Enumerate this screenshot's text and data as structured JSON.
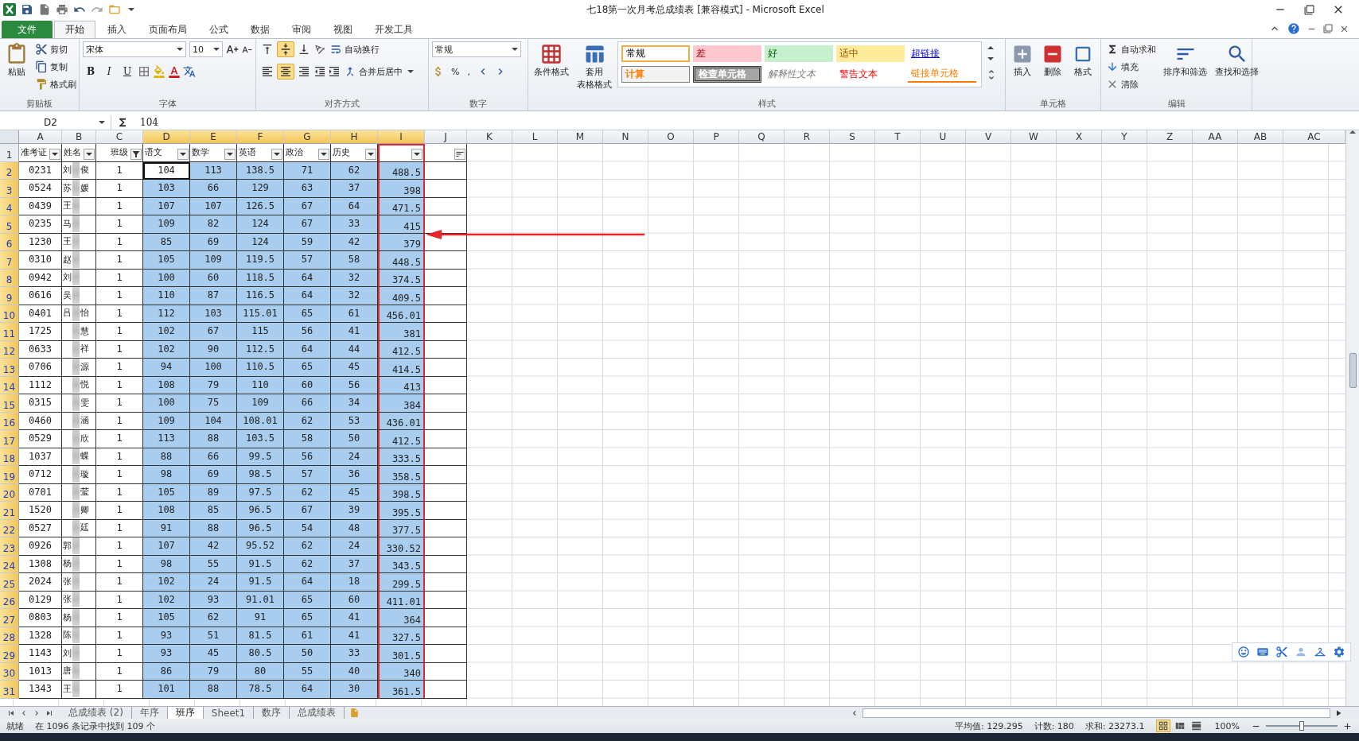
{
  "title_bar": {
    "title": "七18第一次月考总成绩表  [兼容模式]  -  Microsoft Excel"
  },
  "ribbon_tabs": [
    {
      "label": "文件",
      "kind": "file",
      "selected": false
    },
    {
      "label": "开始",
      "kind": "tab",
      "selected": true
    },
    {
      "label": "插入",
      "kind": "tab",
      "selected": false
    },
    {
      "label": "页面布局",
      "kind": "tab",
      "selected": false
    },
    {
      "label": "公式",
      "kind": "tab",
      "selected": false
    },
    {
      "label": "数据",
      "kind": "tab",
      "selected": false
    },
    {
      "label": "审阅",
      "kind": "tab",
      "selected": false
    },
    {
      "label": "视图",
      "kind": "tab",
      "selected": false
    },
    {
      "label": "开发工具",
      "kind": "tab",
      "selected": false
    }
  ],
  "clipboard": {
    "paste": "粘贴",
    "cut": "剪切",
    "copy": "复制",
    "format_painter": "格式刷",
    "label": "剪贴板"
  },
  "font": {
    "name": "宋体",
    "size": "10",
    "buttons": [
      "B",
      "I",
      "U"
    ],
    "label": "字体"
  },
  "alignment": {
    "vertical": [
      {
        "selected": false
      },
      {
        "selected": true
      },
      {
        "selected": false
      }
    ],
    "horizontal": [
      {
        "selected": false
      },
      {
        "selected": true
      },
      {
        "selected": false
      }
    ],
    "wrap": "自动换行",
    "merge": "合并后居中",
    "label": "对齐方式"
  },
  "number": {
    "format": "常规",
    "buttons": [
      "%",
      ","
    ],
    "label": "数字"
  },
  "styles": {
    "conditional": "条件格式",
    "table": [
      "套用",
      "表格格式"
    ],
    "cells": [
      {
        "label": "常规",
        "kind": "normal"
      },
      {
        "label": "差",
        "kind": "bad"
      },
      {
        "label": "好",
        "kind": "good"
      },
      {
        "label": "适中",
        "kind": "neutral"
      },
      {
        "label": "超链接",
        "kind": "hyperlink"
      },
      {
        "label": "计算",
        "kind": "calc"
      },
      {
        "label": "检查单元格",
        "kind": "check"
      },
      {
        "label": "解释性文本",
        "kind": "explanatory"
      },
      {
        "label": "警告文本",
        "kind": "warning"
      },
      {
        "label": "链接单元格",
        "kind": "linked"
      }
    ],
    "label": "样式"
  },
  "cells_group": {
    "buttons": [
      "插入",
      "删除",
      "格式"
    ],
    "label": "单元格"
  },
  "editing": {
    "autosum": "自动求和",
    "fill": "填充",
    "clear": "清除",
    "sort": "排序和筛选",
    "find": "查找和选择",
    "label": "编辑"
  },
  "formula_bar": {
    "name_box": "D2",
    "value": "104"
  },
  "sheet": {
    "columns": [
      {
        "label": "A",
        "selected": false,
        "outlined": false
      },
      {
        "label": "B",
        "selected": false,
        "outlined": false
      },
      {
        "label": "C",
        "selected": false,
        "outlined": false
      },
      {
        "label": "D",
        "selected": true,
        "outlined": false
      },
      {
        "label": "E",
        "selected": true,
        "outlined": false
      },
      {
        "label": "F",
        "selected": true,
        "outlined": false
      },
      {
        "label": "G",
        "selected": true,
        "outlined": false
      },
      {
        "label": "H",
        "selected": true,
        "outlined": false
      },
      {
        "label": "I",
        "selected": true,
        "outlined": true
      },
      {
        "label": "J",
        "selected": false,
        "outlined": false
      },
      {
        "label": "K",
        "selected": false,
        "outlined": false
      },
      {
        "label": "L",
        "selected": false,
        "outlined": false
      },
      {
        "label": "M",
        "selected": false,
        "outlined": false
      },
      {
        "label": "N",
        "selected": false,
        "outlined": false
      },
      {
        "label": "O",
        "selected": false,
        "outlined": false
      },
      {
        "label": "P",
        "selected": false,
        "outlined": false
      },
      {
        "label": "Q",
        "selected": false,
        "outlined": false
      },
      {
        "label": "R",
        "selected": false,
        "outlined": false
      },
      {
        "label": "S",
        "selected": false,
        "outlined": false
      },
      {
        "label": "T",
        "selected": false,
        "outlined": false
      },
      {
        "label": "U",
        "selected": false,
        "outlined": false
      },
      {
        "label": "V",
        "selected": false,
        "outlined": false
      },
      {
        "label": "W",
        "selected": false,
        "outlined": false
      },
      {
        "label": "X",
        "selected": false,
        "outlined": false
      },
      {
        "label": "Y",
        "selected": false,
        "outlined": false
      },
      {
        "label": "Z",
        "selected": false,
        "outlined": false
      },
      {
        "label": "AA",
        "selected": false,
        "outlined": false
      },
      {
        "label": "AB",
        "selected": false,
        "outlined": false
      },
      {
        "label": "AC",
        "selected": false,
        "outlined": false
      }
    ],
    "header_row": {
      "num": "1",
      "cells": [
        {
          "text": "准考证",
          "kind": "dropdown"
        },
        {
          "text": "姓名",
          "kind": "dropdown"
        },
        {
          "text": "班级",
          "kind": "filtered"
        },
        {
          "text": "语文",
          "kind": "dropdown"
        },
        {
          "text": "数学",
          "kind": "dropdown"
        },
        {
          "text": "英语",
          "kind": "dropdown"
        },
        {
          "text": "政治",
          "kind": "dropdown"
        },
        {
          "text": "历史",
          "kind": "dropdown"
        },
        {
          "kind": "dropdown"
        },
        {
          "kind": "sort"
        }
      ]
    },
    "rows": [
      {
        "num": "2",
        "selected": true,
        "active": true,
        "id": "0231",
        "name": {
          "left": "刘",
          "right": "俊"
        },
        "class": "1",
        "scores": [
          "104",
          "113",
          "138.5",
          "71",
          "62"
        ],
        "total": "488.5"
      },
      {
        "num": "3",
        "selected": true,
        "active": false,
        "id": "0524",
        "name": {
          "left": "苏",
          "right": "媛"
        },
        "class": "1",
        "scores": [
          "103",
          "66",
          "129",
          "63",
          "37"
        ],
        "total": "398"
      },
      {
        "num": "4",
        "selected": true,
        "active": false,
        "id": "0439",
        "name": {
          "left": "王"
        },
        "class": "1",
        "scores": [
          "107",
          "107",
          "126.5",
          "67",
          "64"
        ],
        "total": "471.5"
      },
      {
        "num": "5",
        "selected": true,
        "active": false,
        "id": "0235",
        "name": {
          "left": "马"
        },
        "class": "1",
        "scores": [
          "109",
          "82",
          "124",
          "67",
          "33"
        ],
        "total": "415"
      },
      {
        "num": "6",
        "selected": true,
        "active": false,
        "id": "1230",
        "name": {
          "left": "王"
        },
        "class": "1",
        "scores": [
          "85",
          "69",
          "124",
          "59",
          "42"
        ],
        "total": "379"
      },
      {
        "num": "7",
        "selected": true,
        "active": false,
        "id": "0310",
        "name": {
          "left": "赵"
        },
        "class": "1",
        "scores": [
          "105",
          "109",
          "119.5",
          "57",
          "58"
        ],
        "total": "448.5"
      },
      {
        "num": "8",
        "selected": true,
        "active": false,
        "id": "0942",
        "name": {
          "left": "刘"
        },
        "class": "1",
        "scores": [
          "100",
          "60",
          "118.5",
          "64",
          "32"
        ],
        "total": "374.5"
      },
      {
        "num": "9",
        "selected": true,
        "active": false,
        "id": "0616",
        "name": {
          "left": "吴"
        },
        "class": "1",
        "scores": [
          "110",
          "87",
          "116.5",
          "64",
          "32"
        ],
        "total": "409.5"
      },
      {
        "num": "10",
        "selected": true,
        "active": false,
        "id": "0401",
        "name": {
          "left": "吕",
          "right": "怡"
        },
        "class": "1",
        "scores": [
          "112",
          "103",
          "115.01",
          "65",
          "61"
        ],
        "total": "456.01"
      },
      {
        "num": "11",
        "selected": true,
        "active": false,
        "id": "1725",
        "name": {
          "right": "慧"
        },
        "class": "1",
        "scores": [
          "102",
          "67",
          "115",
          "56",
          "41"
        ],
        "total": "381"
      },
      {
        "num": "12",
        "selected": true,
        "active": false,
        "id": "0633",
        "name": {
          "right": "祥"
        },
        "class": "1",
        "scores": [
          "102",
          "90",
          "112.5",
          "64",
          "44"
        ],
        "total": "412.5"
      },
      {
        "num": "13",
        "selected": true,
        "active": false,
        "id": "0706",
        "name": {
          "right": "源"
        },
        "class": "1",
        "scores": [
          "94",
          "100",
          "110.5",
          "65",
          "45"
        ],
        "total": "414.5"
      },
      {
        "num": "14",
        "selected": true,
        "active": false,
        "id": "1112",
        "name": {
          "right": "悦"
        },
        "class": "1",
        "scores": [
          "108",
          "79",
          "110",
          "60",
          "56"
        ],
        "total": "413"
      },
      {
        "num": "15",
        "selected": true,
        "active": false,
        "id": "0315",
        "name": {
          "right": "雯"
        },
        "class": "1",
        "scores": [
          "100",
          "75",
          "109",
          "66",
          "34"
        ],
        "total": "384"
      },
      {
        "num": "16",
        "selected": true,
        "active": false,
        "id": "0460",
        "name": {
          "right": "涵"
        },
        "class": "1",
        "scores": [
          "109",
          "104",
          "108.01",
          "62",
          "53"
        ],
        "total": "436.01"
      },
      {
        "num": "17",
        "selected": true,
        "active": false,
        "id": "0529",
        "name": {
          "right": "欣"
        },
        "class": "1",
        "scores": [
          "113",
          "88",
          "103.5",
          "58",
          "50"
        ],
        "total": "412.5"
      },
      {
        "num": "18",
        "selected": true,
        "active": false,
        "id": "1037",
        "name": {
          "right": "蝶"
        },
        "class": "1",
        "scores": [
          "88",
          "66",
          "99.5",
          "56",
          "24"
        ],
        "total": "333.5"
      },
      {
        "num": "19",
        "selected": true,
        "active": false,
        "id": "0712",
        "name": {
          "right": "璇"
        },
        "class": "1",
        "scores": [
          "98",
          "69",
          "98.5",
          "57",
          "36"
        ],
        "total": "358.5"
      },
      {
        "num": "20",
        "selected": true,
        "active": false,
        "id": "0701",
        "name": {
          "right": "莹"
        },
        "class": "1",
        "scores": [
          "105",
          "89",
          "97.5",
          "62",
          "45"
        ],
        "total": "398.5"
      },
      {
        "num": "21",
        "selected": true,
        "active": false,
        "id": "1520",
        "name": {
          "right": "卿"
        },
        "class": "1",
        "scores": [
          "108",
          "85",
          "96.5",
          "67",
          "39"
        ],
        "total": "395.5"
      },
      {
        "num": "22",
        "selected": true,
        "active": false,
        "id": "0527",
        "name": {
          "right": "廷"
        },
        "class": "1",
        "scores": [
          "91",
          "88",
          "96.5",
          "54",
          "48"
        ],
        "total": "377.5"
      },
      {
        "num": "23",
        "selected": true,
        "active": false,
        "id": "0926",
        "name": {
          "left": "郭"
        },
        "class": "1",
        "scores": [
          "107",
          "42",
          "95.52",
          "62",
          "24"
        ],
        "total": "330.52"
      },
      {
        "num": "24",
        "selected": true,
        "active": false,
        "id": "1308",
        "name": {
          "left": "杨"
        },
        "class": "1",
        "scores": [
          "98",
          "55",
          "91.5",
          "62",
          "37"
        ],
        "total": "343.5"
      },
      {
        "num": "25",
        "selected": true,
        "active": false,
        "id": "2024",
        "name": {
          "left": "张"
        },
        "class": "1",
        "scores": [
          "102",
          "24",
          "91.5",
          "64",
          "18"
        ],
        "total": "299.5"
      },
      {
        "num": "26",
        "selected": true,
        "active": false,
        "id": "0129",
        "name": {
          "left": "张"
        },
        "class": "1",
        "scores": [
          "102",
          "93",
          "91.01",
          "65",
          "60"
        ],
        "total": "411.01"
      },
      {
        "num": "27",
        "selected": true,
        "active": false,
        "id": "0803",
        "name": {
          "left": "杨"
        },
        "class": "1",
        "scores": [
          "105",
          "62",
          "91",
          "65",
          "41"
        ],
        "total": "364"
      },
      {
        "num": "28",
        "selected": true,
        "active": false,
        "id": "1328",
        "name": {
          "left": "陈"
        },
        "class": "1",
        "scores": [
          "93",
          "51",
          "81.5",
          "61",
          "41"
        ],
        "total": "327.5"
      },
      {
        "num": "29",
        "selected": true,
        "active": false,
        "id": "1143",
        "name": {
          "left": "刘"
        },
        "class": "1",
        "scores": [
          "93",
          "45",
          "80.5",
          "50",
          "33"
        ],
        "total": "301.5"
      },
      {
        "num": "30",
        "selected": true,
        "active": false,
        "id": "1013",
        "name": {
          "left": "唐"
        },
        "class": "1",
        "scores": [
          "86",
          "79",
          "80",
          "55",
          "40"
        ],
        "total": "340"
      },
      {
        "num": "31",
        "selected": true,
        "active": false,
        "id": "1343",
        "name": {
          "left": "王"
        },
        "class": "1",
        "scores": [
          "101",
          "88",
          "78.5",
          "64",
          "30"
        ],
        "total": "361.5"
      }
    ]
  },
  "sheet_tabs": [
    {
      "label": "总成绩表 (2)",
      "selected": false
    },
    {
      "label": "年序",
      "selected": false
    },
    {
      "label": "班序",
      "selected": true
    },
    {
      "label": "Sheet1",
      "selected": false
    },
    {
      "label": "数序",
      "selected": false
    },
    {
      "label": "总成绩表",
      "selected": false
    }
  ],
  "status_bar": {
    "ready": "就绪",
    "message": "在 1096 条记录中找到 109 个",
    "average": "平均值: 129.295",
    "count": "计数: 180",
    "sum": "求和: 23273.1",
    "views": [
      {
        "kind": "normal",
        "selected": true
      },
      {
        "kind": "layout",
        "selected": false
      },
      {
        "kind": "pagebreak",
        "selected": false
      }
    ],
    "zoom": "100%",
    "zoom_level": {
      "level": 0.5
    }
  }
}
